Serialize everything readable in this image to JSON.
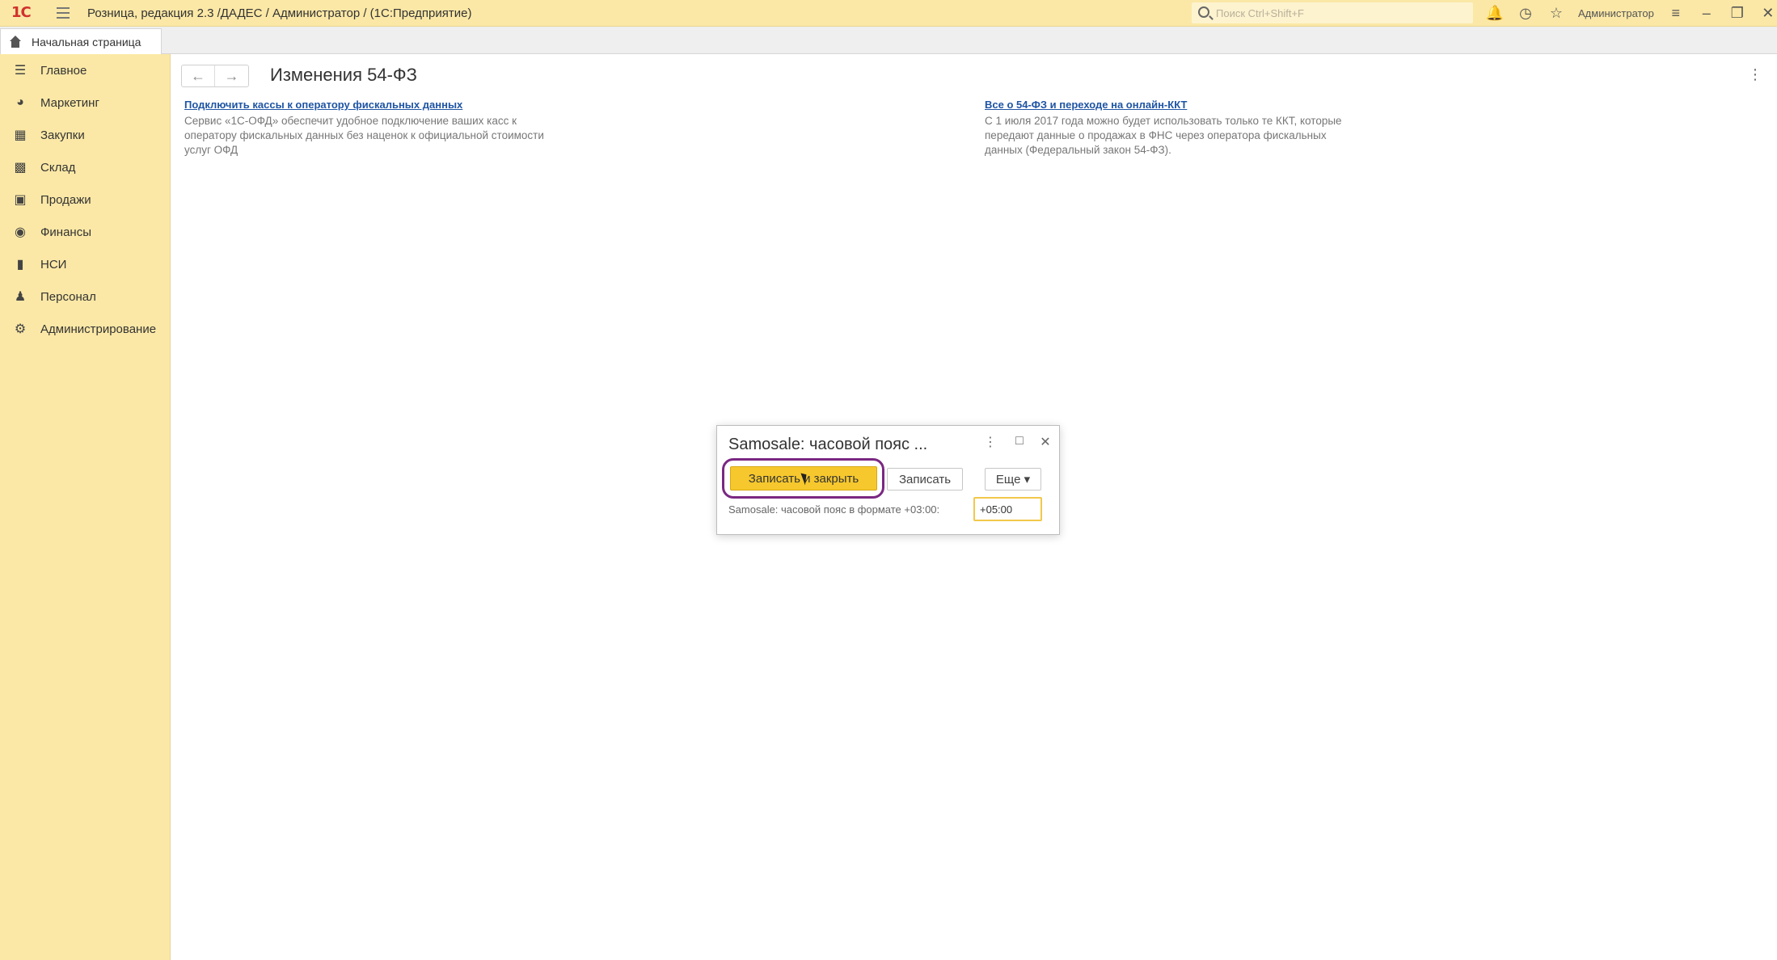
{
  "app": {
    "logo": "1С",
    "title": "Розница, редакция 2.3 /ДАДЕС / Администратор /  (1С:Предприятие)",
    "search_placeholder": "Поиск Ctrl+Shift+F",
    "user": "Администратор",
    "icons": [
      "bell-icon",
      "history-icon",
      "star-icon",
      "settings-icon",
      "minimize-icon",
      "restore-icon",
      "close-icon"
    ]
  },
  "tabs": {
    "home": "Начальная страница"
  },
  "sidebar": {
    "items": [
      {
        "label": "Главное",
        "icon": "menu-lines-icon"
      },
      {
        "label": "Маркетинг",
        "icon": "chart-pie-icon"
      },
      {
        "label": "Закупки",
        "icon": "cart-icon"
      },
      {
        "label": "Склад",
        "icon": "grid-icon"
      },
      {
        "label": "Продажи",
        "icon": "bag-icon"
      },
      {
        "label": "Финансы",
        "icon": "coin-icon"
      },
      {
        "label": "НСИ",
        "icon": "book-icon"
      },
      {
        "label": "Персонал",
        "icon": "person-icon"
      },
      {
        "label": "Администрирование",
        "icon": "gear-icon"
      }
    ]
  },
  "main": {
    "title": "Изменения 54-ФЗ",
    "left_block": {
      "link": "Подключить кассы к оператору фискальных данных",
      "text": "Сервис «1С-ОФД» обеспечит удобное подключение ваших касс к оператору фискальных данных без наценок к официальной стоимости услуг ОФД"
    },
    "right_block": {
      "link": "Все о 54-ФЗ и переходе на онлайн-ККТ",
      "text": "С 1 июля 2017 года можно будет использовать только те ККТ, которые передают данные о продажах в ФНС через оператора фискальных данных (Федеральный закон 54-ФЗ)."
    }
  },
  "dialog": {
    "title": "Samosale: часовой пояс ...",
    "btn_save_close": "Записать и закрыть",
    "btn_save": "Записать",
    "btn_more": "Еще ▾",
    "field_label": "Samosale: часовой пояс в формате +03:00:",
    "field_value": "+05:00"
  }
}
